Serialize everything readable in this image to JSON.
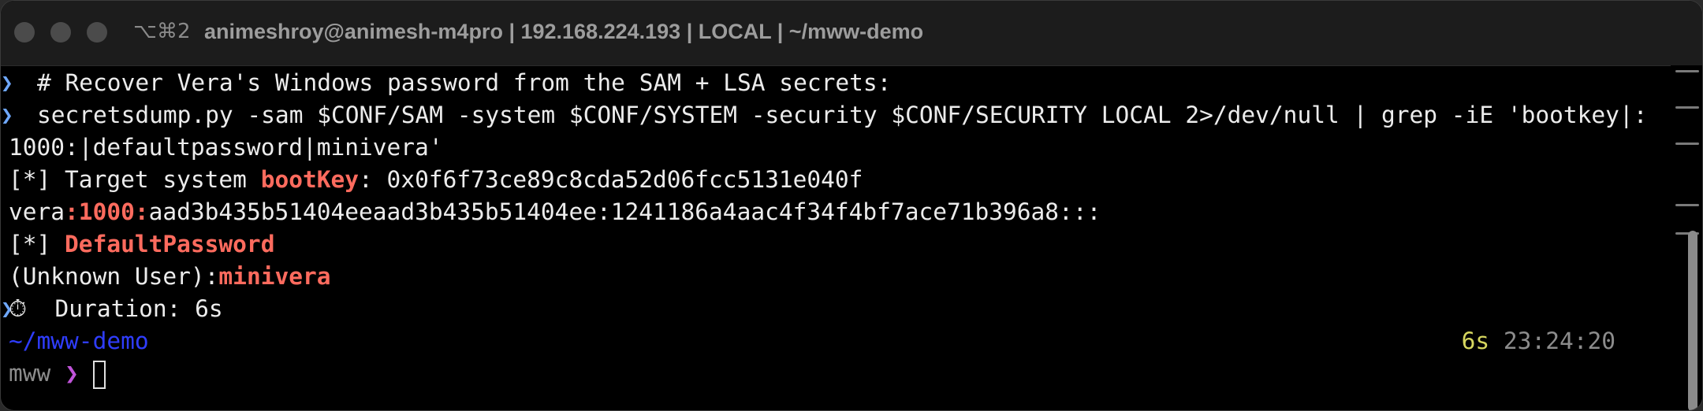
{
  "window": {
    "shortcut": "⌥⌘2",
    "title": "animeshroy@animesh-m4pro | 192.168.224.193 | LOCAL | ~/mww-demo"
  },
  "terminal": {
    "lines": {
      "l1": "# Recover Vera's Windows password from the SAM + LSA secrets:",
      "l2": "secretsdump.py -sam $CONF/SAM -system $CONF/SYSTEM -security $CONF/SECURITY LOCAL 2>/dev/null | grep -iE 'bootkey|:",
      "l3": "1000:|defaultpassword|minivera'",
      "l4_prefix": "[*] Target system ",
      "l4_key": "bootKey",
      "l4_value": ": 0x0f6f73ce89c8cda52d06fcc5131e040f",
      "l5_user": "vera",
      "l5_rid": ":1000:",
      "l5_hash": "aad3b435b51404eeaad3b435b51404ee:1241186a4aac4f34f4bf7ace71b396a8:::",
      "l6_prefix": "[*] ",
      "l6_key": "DefaultPassword",
      "l7_prefix": "(Unknown User):",
      "l7_value": "minivera",
      "l8_icon": "⏱",
      "l8_text": "  Duration: 6s"
    },
    "prompt": {
      "cwd": "~/mww-demo",
      "elapsed": "6s",
      "time": "23:24:20",
      "env": "mww",
      "arrow": "❯"
    }
  },
  "colors": {
    "background": "#000000",
    "highlight_red": "#ff6b5e",
    "cwd_blue": "#2f3dff",
    "elapsed_yellow": "#d7d75f",
    "prompt_purple": "#c054d9"
  }
}
